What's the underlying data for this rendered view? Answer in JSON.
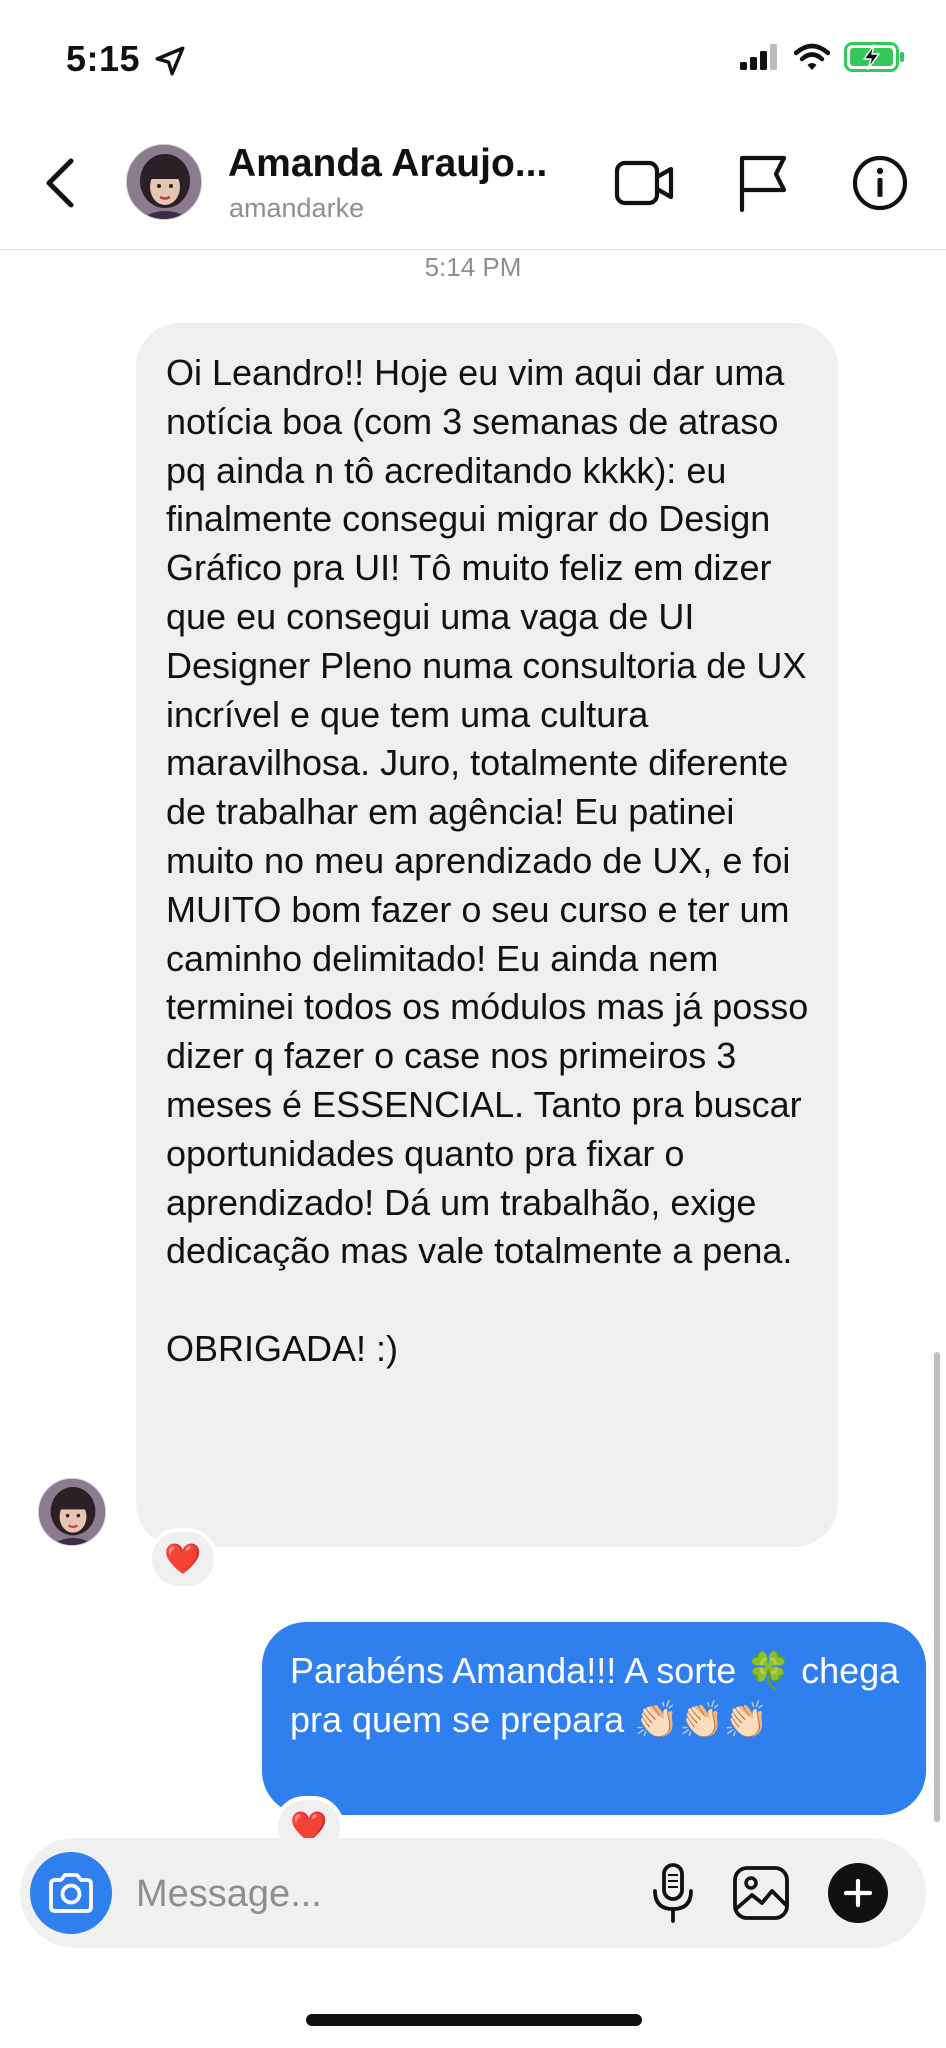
{
  "status_bar": {
    "time": "5:15"
  },
  "header": {
    "contact_name": "Amanda Araujo...",
    "contact_handle": "amandarke"
  },
  "chat": {
    "timestamp": "5:14 PM",
    "incoming": {
      "text": "Oi Leandro!! Hoje eu vim aqui dar uma notícia boa (com 3 semanas de atraso pq ainda n tô acreditando kkkk): eu finalmente consegui migrar do Design Gráfico pra UI! Tô muito feliz em dizer que eu consegui uma vaga de UI Designer Pleno numa consultoria de UX incrível e que tem uma cultura maravilhosa. Juro, totalmente diferente de trabalhar em agência! Eu patinei muito no meu aprendizado de UX, e foi MUITO bom fazer o seu curso e ter um caminho delimitado! Eu ainda nem terminei todos os módulos mas já posso dizer q fazer o case nos primeiros 3 meses é ESSENCIAL. Tanto pra buscar oportunidades quanto pra fixar o aprendizado! Dá um trabalhão, exige dedicação mas vale totalmente a pena.\n\nOBRIGADA! :)",
      "reaction": "❤️"
    },
    "outgoing": {
      "text": "Parabéns Amanda!!! A sorte 🍀 chega pra quem se prepara 👏🏻👏🏻👏🏻",
      "reaction": "❤️"
    }
  },
  "composer": {
    "placeholder": "Message..."
  },
  "colors": {
    "accent": "#2f7fef",
    "incoming_bubble": "#efefef",
    "battery": "#34c759"
  },
  "icons": [
    "location-arrow-icon",
    "cellular-signal-icon",
    "wifi-icon",
    "battery-charging-icon",
    "back-chevron-icon",
    "video-call-icon",
    "flag-icon",
    "info-icon",
    "camera-icon",
    "microphone-icon",
    "gallery-icon",
    "plus-icon",
    "heart-icon"
  ]
}
